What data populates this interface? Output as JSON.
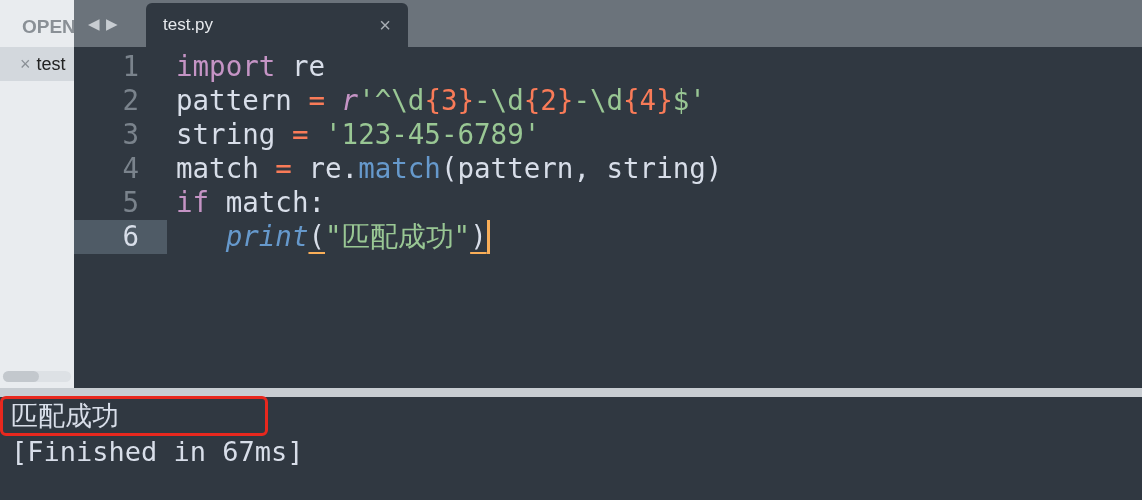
{
  "sidebar": {
    "header": "OPEN",
    "items": [
      {
        "label": "test",
        "selected": true,
        "close": "×"
      }
    ]
  },
  "tabs": {
    "nav": [
      "◀",
      "▶"
    ],
    "items": [
      {
        "label": "test.py",
        "selected": true,
        "close": "×"
      }
    ]
  },
  "editor": {
    "lines": [
      {
        "number": "1",
        "current": false,
        "tokens": [
          {
            "text": "import",
            "kind": "keyword"
          },
          {
            "text": " re",
            "kind": "plain"
          }
        ]
      },
      {
        "number": "2",
        "current": false,
        "tokens": [
          {
            "text": "pattern ",
            "kind": "plain"
          },
          {
            "text": "= ",
            "kind": "operator"
          },
          {
            "text": "r",
            "kind": "storage"
          },
          {
            "text": "'^\\d",
            "kind": "string"
          },
          {
            "text": "{3}",
            "kind": "operator"
          },
          {
            "text": "-\\d",
            "kind": "string"
          },
          {
            "text": "{2}",
            "kind": "operator"
          },
          {
            "text": "-\\d",
            "kind": "string"
          },
          {
            "text": "{4}",
            "kind": "operator"
          },
          {
            "text": "$'",
            "kind": "string"
          }
        ]
      },
      {
        "number": "3",
        "current": false,
        "tokens": [
          {
            "text": "string ",
            "kind": "plain"
          },
          {
            "text": "= ",
            "kind": "operator"
          },
          {
            "text": "'123-45-6789'",
            "kind": "string"
          }
        ]
      },
      {
        "number": "4",
        "current": false,
        "tokens": [
          {
            "text": "match ",
            "kind": "plain"
          },
          {
            "text": "=",
            "kind": "operator"
          },
          {
            "text": " re.",
            "kind": "plain"
          },
          {
            "text": "match",
            "kind": "function"
          },
          {
            "text": "(pattern, string)",
            "kind": "plain"
          }
        ]
      },
      {
        "number": "5",
        "current": false,
        "tokens": [
          {
            "text": "if",
            "kind": "keyword"
          },
          {
            "text": " match:",
            "kind": "plain"
          }
        ]
      },
      {
        "number": "6",
        "current": true,
        "tokens": [
          {
            "text": "   print",
            "kind": "builtin"
          },
          {
            "text": "(",
            "kind": "bracket"
          },
          {
            "text": "\"匹配成功\"",
            "kind": "string"
          },
          {
            "text": ")",
            "kind": "bracket"
          }
        ]
      }
    ]
  },
  "output": {
    "lines": [
      {
        "text": "匹配成功",
        "highlighted": true
      },
      {
        "text": "[Finished in 67ms]",
        "highlighted": false
      }
    ]
  }
}
